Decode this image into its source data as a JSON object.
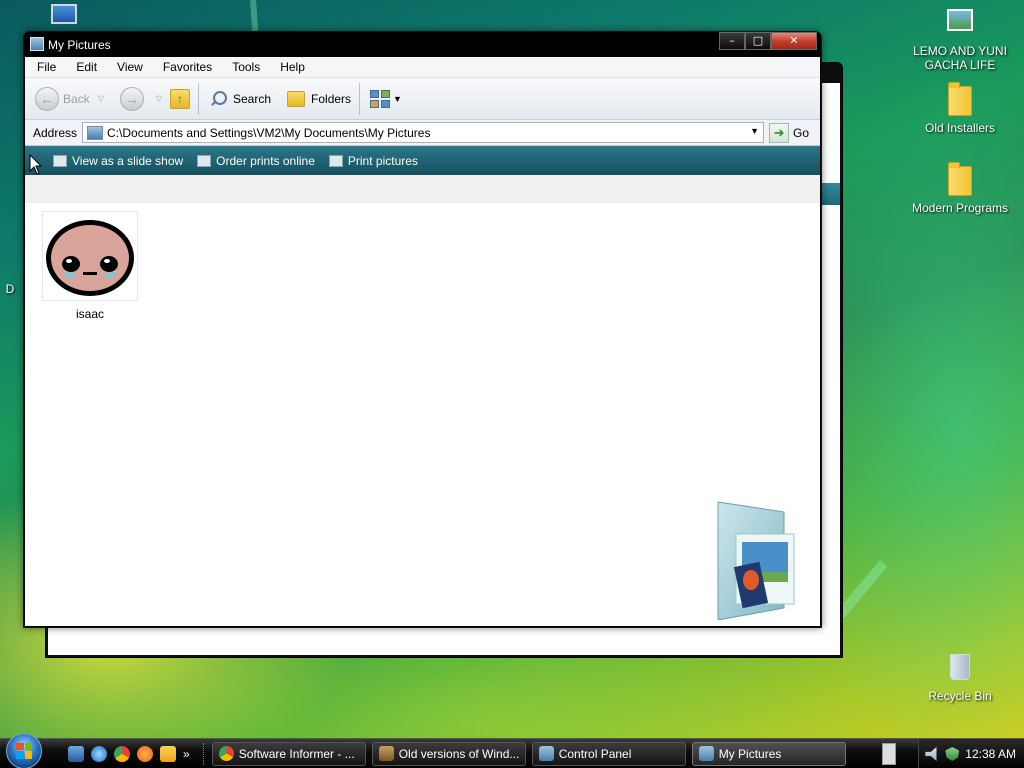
{
  "desktop": {
    "icons": [
      {
        "label": "LEMO AND YUNI GACHA LIFE",
        "icon": "image-file-icon"
      },
      {
        "label": "Old Installers",
        "icon": "folder-icon"
      },
      {
        "label": "Modern Programs",
        "icon": "folder-icon"
      },
      {
        "label": "Recycle Bin",
        "icon": "recycle-bin-icon"
      }
    ],
    "partial_label": "D"
  },
  "window": {
    "title": "My Pictures",
    "menu": [
      "File",
      "Edit",
      "View",
      "Favorites",
      "Tools",
      "Help"
    ],
    "toolbar": {
      "back": "Back",
      "search": "Search",
      "folders": "Folders"
    },
    "address": {
      "label": "Address",
      "path": "C:\\Documents and Settings\\VM2\\My Documents\\My Pictures",
      "go": "Go"
    },
    "tasks": [
      "View as a slide show",
      "Order prints online",
      "Print pictures"
    ],
    "files": [
      {
        "name": "isaac",
        "type": "image"
      }
    ]
  },
  "taskbar": {
    "buttons": [
      {
        "label": "Software Informer - ...",
        "icon": "chrome-icon"
      },
      {
        "label": "Old versions of Wind...",
        "icon": "app-icon"
      },
      {
        "label": "Control Panel",
        "icon": "control-panel-icon"
      },
      {
        "label": "My Pictures",
        "icon": "folder-window-icon",
        "active": true
      }
    ],
    "quick_launch_overflow": "»",
    "clock": "12:38 AM"
  },
  "colors": {
    "wallpaper": "#1a9a5a",
    "task_pane": "#2b7788",
    "close_button": "#c0392b"
  }
}
